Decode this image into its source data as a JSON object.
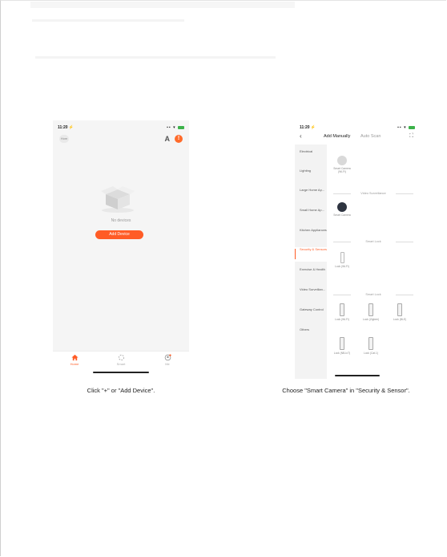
{
  "steps": [
    {
      "phone": {
        "status_time": "11:20 ⚡",
        "home_name": "Hom",
        "add_icon": "plus-icon",
        "notice_icon": "alert-badge-icon",
        "empty_text": "No devices",
        "add_button": "Add Device",
        "tabs": [
          {
            "label": "Home",
            "icon": "home-icon"
          },
          {
            "label": "Smart",
            "icon": "smart-icon"
          },
          {
            "label": "Me",
            "icon": "profile-icon"
          }
        ]
      },
      "caption": "Click \"+\" or \"Add Device\"."
    },
    {
      "phone": {
        "status_time": "11:20 ⚡",
        "back_icon": "chevron-left-icon",
        "tab_manual": "Add Manually",
        "tab_auto": "Auto Scan",
        "scan_icon": "scan-icon",
        "categories": [
          "Electrical",
          "Lighting",
          "Large Home Ap...",
          "Small Home Ap...",
          "Kitchen Appliances",
          "Security & Sensors",
          "Exercise & Health",
          "Video Surveillan...",
          "Gateway Control",
          "Others"
        ],
        "selected_category": 5,
        "top_product": "Smart Camera (Wi-Fi)",
        "section1": "Video Surveillance",
        "section1_product": "Smart Camera",
        "section2": "Smart Lock",
        "section2_product": "Lock (Wi-Fi)",
        "section3": "Smart Lock",
        "locks": [
          "Lock (Wi-Fi)",
          "Lock (Zigbee)",
          "Lock (BLE)",
          "Lock (NB-IoT)",
          "Lock (Cat.1)"
        ]
      },
      "caption": "Choose \"Smart Camera\" in \"Security & Sensor\"."
    }
  ],
  "colors": {
    "accent": "#ff5c26",
    "badge": "#ff6b2b",
    "background": "#f5f5f5"
  }
}
